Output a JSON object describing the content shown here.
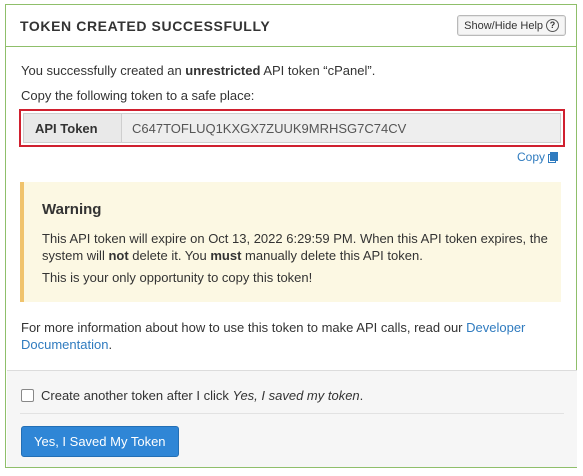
{
  "header": {
    "title": "TOKEN CREATED SUCCESSFULLY",
    "help_button_label": "Show/Hide Help",
    "help_icon_glyph": "?"
  },
  "body": {
    "intro_before": "You successfully created an ",
    "intro_bold": "unrestricted",
    "intro_after": " API token “cPanel”.",
    "copy_instruction": "Copy the following token to a safe place:",
    "token_label": "API Token",
    "token_value": "C647TOFLUQ1KXGX7ZUUK9MRHSG7C74CV",
    "copy_link_label": "Copy"
  },
  "warning": {
    "title": "Warning",
    "p1_a": "This API token will expire on Oct 13, 2022 6:29:59 PM. When this API token expires, the system will ",
    "p1_not": "not",
    "p1_b": " delete it. You ",
    "p1_must": "must",
    "p1_c": " manually delete this API token.",
    "p2": "This is your only opportunity to copy this token!"
  },
  "info": {
    "text": "For more information about how to use this token to make API calls, read our ",
    "link_label": "Developer Documentation",
    "end": "."
  },
  "footer": {
    "checkbox_label_a": "Create another token after I click ",
    "checkbox_label_em": "Yes, I saved my token",
    "checkbox_label_end": ".",
    "primary_button_label": "Yes, I Saved My Token"
  },
  "colors": {
    "panel_border": "#8fbf6a",
    "highlight_border": "#d0202f",
    "link": "#2f7bbf",
    "warning_bg": "#fcf8e3",
    "warning_border": "#f0c36d",
    "primary_button": "#2f86d6"
  },
  "icons": {
    "help": "question-circle-icon",
    "copy": "copy-icon"
  }
}
